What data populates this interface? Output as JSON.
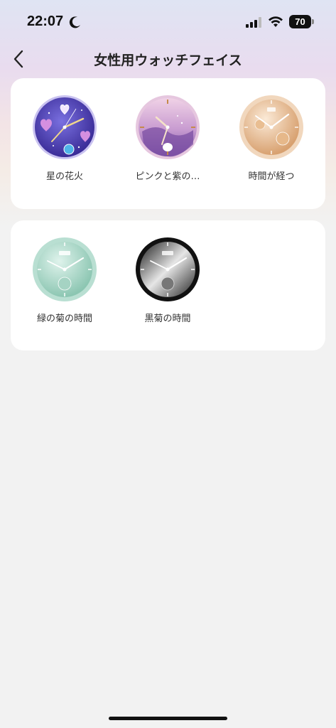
{
  "status_bar": {
    "time": "22:07",
    "battery": "70",
    "icons": [
      "moon-icon",
      "signal-icon",
      "wifi-icon",
      "battery-icon"
    ]
  },
  "header": {
    "title": "女性用ウォッチフェイス",
    "back_icon": "chevron-left-icon"
  },
  "groups": [
    {
      "faces": [
        {
          "label": "星の花火",
          "style": "purple-heart",
          "dial_colors": [
            "#6a5fd0",
            "#3d2f9e"
          ]
        },
        {
          "label": "ピンクと紫の…",
          "style": "pink-purple",
          "dial_colors": [
            "#e8c0dc",
            "#8b5fb0"
          ]
        },
        {
          "label": "時間が経つ",
          "style": "champagne",
          "dial_colors": [
            "#f3dcc0",
            "#d9a874"
          ]
        }
      ]
    },
    {
      "faces": [
        {
          "label": "緑の菊の時間",
          "style": "mint",
          "dial_colors": [
            "#c8e9df",
            "#7fbfaa"
          ]
        },
        {
          "label": "黒菊の時間",
          "style": "black",
          "dial_colors": [
            "#d9d9d9",
            "#1a1a1a"
          ]
        }
      ]
    }
  ],
  "colors": {
    "background": "#f2f2f2",
    "card": "#ffffff",
    "text": "#222222"
  }
}
